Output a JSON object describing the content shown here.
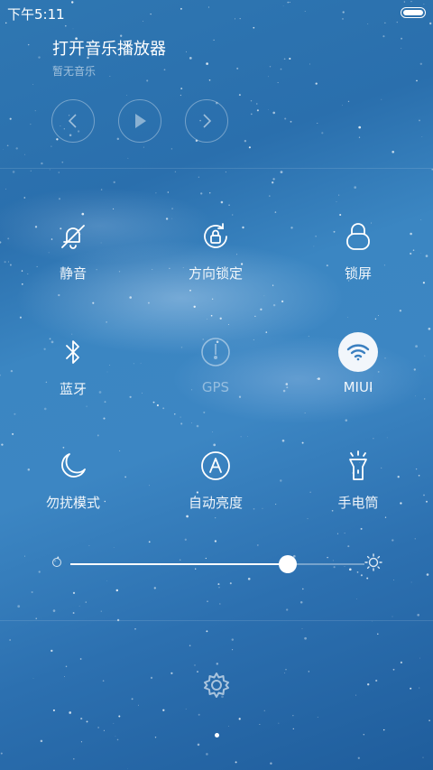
{
  "status_bar": {
    "time": "下午5:11",
    "battery_level": 1.0
  },
  "music": {
    "title": "打开音乐播放器",
    "subtitle": "暂无音乐",
    "controls": [
      "previous-icon",
      "play-icon",
      "next-icon"
    ]
  },
  "toggles": [
    {
      "id": "mute",
      "label": "静音",
      "icon": "bell-off-icon",
      "active": false
    },
    {
      "id": "rotation-lock",
      "label": "方向锁定",
      "icon": "rotation-lock-icon",
      "active": false
    },
    {
      "id": "lock-screen",
      "label": "锁屏",
      "icon": "lock-icon",
      "active": false
    },
    {
      "id": "bluetooth",
      "label": "蓝牙",
      "icon": "bluetooth-icon",
      "active": false
    },
    {
      "id": "gps",
      "label": "GPS",
      "icon": "gps-icon",
      "active": false
    },
    {
      "id": "wifi",
      "label": "MIUI",
      "icon": "wifi-icon",
      "active": true
    },
    {
      "id": "do-not-disturb",
      "label": "勿扰模式",
      "icon": "moon-icon",
      "active": false
    },
    {
      "id": "auto-brightness",
      "label": "自动亮度",
      "icon": "auto-brightness-icon",
      "active": false
    },
    {
      "id": "flashlight",
      "label": "手电筒",
      "icon": "flashlight-icon",
      "active": false
    }
  ],
  "brightness": {
    "value": 0.74
  },
  "colors": {
    "accent": "#ffffff",
    "wifi_active_bg": "#f2f6fb",
    "wifi_active_fg": "#3a7fc0"
  },
  "pager": {
    "pages": 1,
    "current": 0
  }
}
